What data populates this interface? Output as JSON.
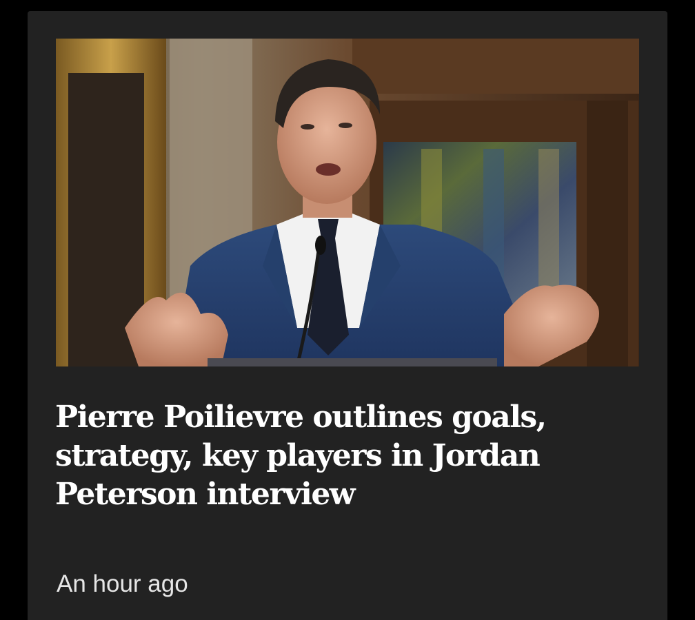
{
  "article": {
    "image_subject": "politician-at-podium-photo",
    "headline": "Pierre Poilievre outlines goals, strategy, key players in Jordan Peterson interview",
    "timestamp": "An hour ago"
  },
  "colors": {
    "page_background": "#000000",
    "card_background": "#222222",
    "headline_text": "#ffffff",
    "timestamp_text": "#e6e6e6"
  }
}
